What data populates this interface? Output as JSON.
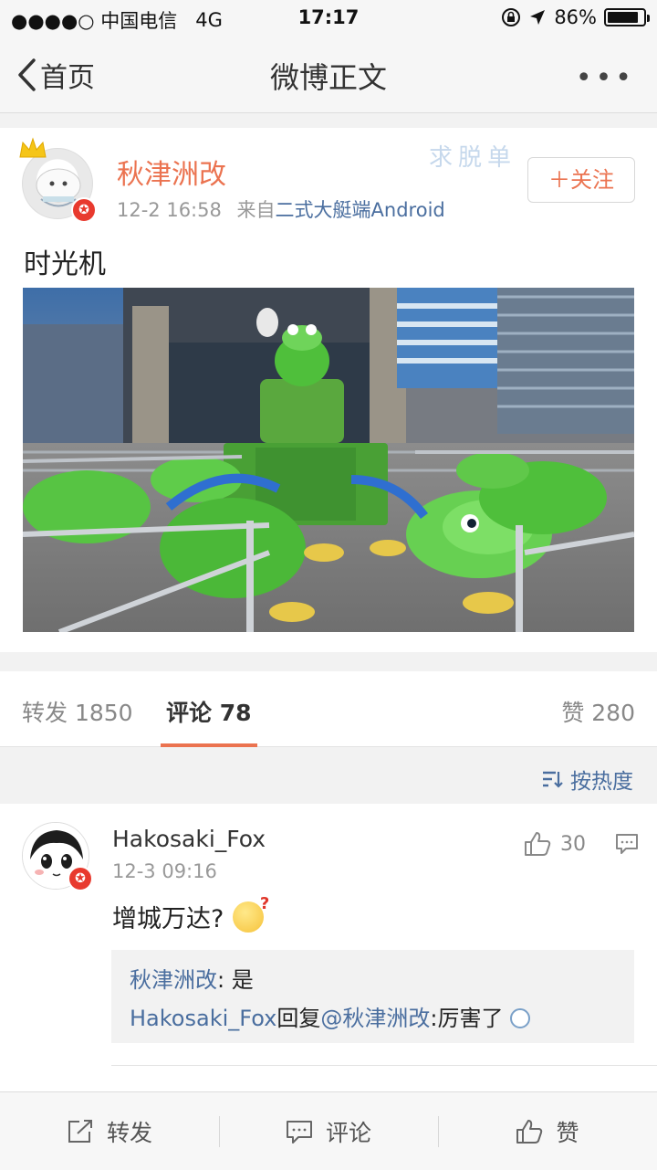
{
  "status_bar": {
    "carrier": "●●●●○ 中国电信",
    "network": "4G",
    "time": "17:17",
    "battery_text": "86%",
    "battery_level": 0.86
  },
  "nav": {
    "back_label": "首页",
    "title": "微博正文",
    "more": "•••"
  },
  "post": {
    "author": "秋津洲改",
    "time": "12-2 16:58",
    "source_prefix": "来自",
    "source": "二式大艇端Android",
    "follow_label": "＋关注",
    "text": "时光机",
    "watermark": "求脱单"
  },
  "tabs": {
    "repost": "转发 1850",
    "comments": "评论 78",
    "likes": "赞 280"
  },
  "sort_label": "按热度",
  "comment": {
    "author": "Hakosaki_Fox",
    "time": "12-3 09:16",
    "likes": "30",
    "text": "增城万达?",
    "replies": [
      {
        "user": "秋津洲改",
        "sep": ": ",
        "text": "是"
      },
      {
        "user": "Hakosaki_Fox",
        "mid": "回复",
        "mention": "@秋津洲改",
        "text": ":厉害了"
      }
    ]
  },
  "bottom": {
    "repost": "转发",
    "comment": "评论",
    "like": "赞"
  },
  "colors": {
    "accent": "#eb7350",
    "link": "#4a6e9f",
    "badge": "#e83a2e"
  }
}
